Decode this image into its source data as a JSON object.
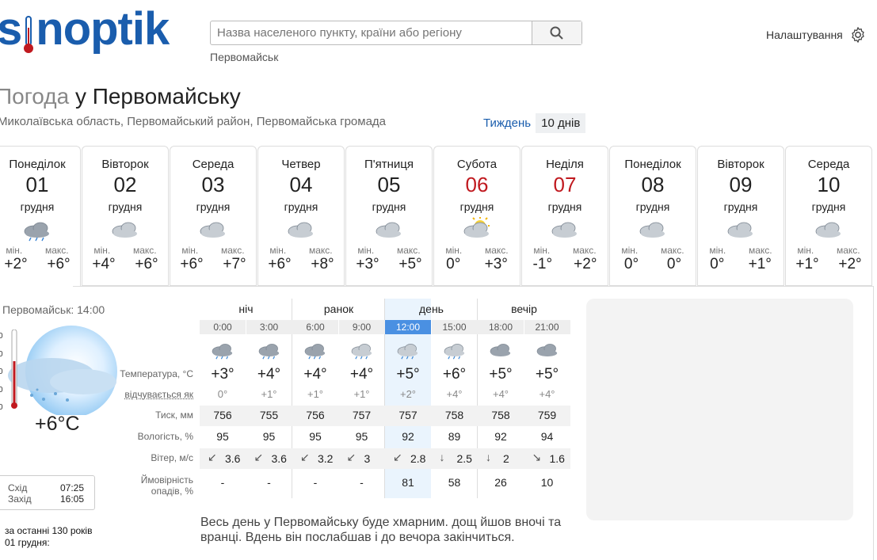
{
  "header": {
    "logo_text": "sinoptik",
    "search_placeholder": "Назва населеного пункту, країни або регіону",
    "suggestion": "Первомайськ",
    "settings_label": "Налаштування"
  },
  "title": {
    "prefix": "Погода",
    "rest": "у Первомайську"
  },
  "region": "Миколаївська область, Первомайський район, Первомайська громада",
  "tabs": {
    "week": "Тиждень",
    "ten_days": "10 днів"
  },
  "days": [
    {
      "weekday": "Понеділок",
      "date": "01",
      "month": "грудня",
      "min_label": "мін.",
      "max_label": "макс.",
      "min": "+2°",
      "max": "+6°",
      "icon": "cloud-rain-icon"
    },
    {
      "weekday": "Вівторок",
      "date": "02",
      "month": "грудня",
      "min_label": "мін.",
      "max_label": "макс.",
      "min": "+4°",
      "max": "+6°",
      "icon": "cloud-icon"
    },
    {
      "weekday": "Середа",
      "date": "03",
      "month": "грудня",
      "min_label": "мін.",
      "max_label": "макс.",
      "min": "+6°",
      "max": "+7°",
      "icon": "cloud-icon"
    },
    {
      "weekday": "Четвер",
      "date": "04",
      "month": "грудня",
      "min_label": "мін.",
      "max_label": "макс.",
      "min": "+6°",
      "max": "+8°",
      "icon": "cloud-icon"
    },
    {
      "weekday": "П'ятниця",
      "date": "05",
      "month": "грудня",
      "min_label": "мін.",
      "max_label": "макс.",
      "min": "+3°",
      "max": "+5°",
      "icon": "cloud-icon"
    },
    {
      "weekday": "Субота",
      "date": "06",
      "month": "грудня",
      "min_label": "мін.",
      "max_label": "макс.",
      "min": "0°",
      "max": "+3°",
      "icon": "sun-cloud-icon"
    },
    {
      "weekday": "Неділя",
      "date": "07",
      "month": "грудня",
      "min_label": "мін.",
      "max_label": "макс.",
      "min": "-1°",
      "max": "+2°",
      "icon": "cloud-icon"
    },
    {
      "weekday": "Понеділок",
      "date": "08",
      "month": "грудня",
      "min_label": "мін.",
      "max_label": "макс.",
      "min": "0°",
      "max": "0°",
      "icon": "cloud-icon"
    },
    {
      "weekday": "Вівторок",
      "date": "09",
      "month": "грудня",
      "min_label": "мін.",
      "max_label": "макс.",
      "min": "0°",
      "max": "+1°",
      "icon": "cloud-icon"
    },
    {
      "weekday": "Середа",
      "date": "10",
      "month": "грудня",
      "min_label": "мін.",
      "max_label": "макс.",
      "min": "+1°",
      "max": "+2°",
      "icon": "cloud-icon"
    }
  ],
  "current": {
    "label": "Первомайськ: 14:00",
    "temp": "+6°C",
    "sunrise_label": "Схід",
    "sunrise": "07:25",
    "sunset_label": "Захід",
    "sunset": "16:05",
    "history_line1": "за останні 130 років",
    "history_line2": "01 грудня:",
    "scale": [
      "0",
      "0",
      "0",
      "0",
      "0"
    ]
  },
  "table": {
    "periods": [
      "ніч",
      "ранок",
      "день",
      "вечір"
    ],
    "times": [
      "0:00",
      "3:00",
      "6:00",
      "9:00",
      "12:00",
      "15:00",
      "18:00",
      "21:00"
    ],
    "labels": {
      "temp": "Температура, °C",
      "feels": "відчувається як",
      "pressure": "Тиск, мм",
      "humidity": "Вологість, %",
      "wind": "Вітер, м/с",
      "precip1": "Ймовірність",
      "precip2": "опадів, %"
    },
    "temp": [
      "+3°",
      "+4°",
      "+4°",
      "+4°",
      "+5°",
      "+6°",
      "+5°",
      "+5°"
    ],
    "feels": [
      "0°",
      "+1°",
      "+1°",
      "+1°",
      "+2°",
      "+4°",
      "+4°",
      "+4°"
    ],
    "pressure": [
      "756",
      "755",
      "756",
      "757",
      "757",
      "758",
      "758",
      "759"
    ],
    "humidity": [
      "95",
      "95",
      "95",
      "95",
      "92",
      "89",
      "92",
      "94"
    ],
    "wind": [
      "3.6",
      "3.6",
      "3.2",
      "3",
      "2.8",
      "2.5",
      "2",
      "1.6"
    ],
    "wind_dir": [
      "↙",
      "↙",
      "↙",
      "↙",
      "↙",
      "↓",
      "↓",
      "↘"
    ],
    "precip": [
      "-",
      "-",
      "-",
      "-",
      "81",
      "58",
      "26",
      "10"
    ],
    "icons": [
      "cloud-rain-icon",
      "cloud-rain-icon",
      "cloud-rain-icon",
      "cloud-drizzle-icon",
      "cloud-drizzle-icon",
      "cloud-drizzle-icon",
      "cloud-dark-icon",
      "cloud-dark-icon"
    ]
  },
  "description": "Весь день у Первомайську буде хмарним. дощ йшов вночі та вранці. Вдень він послабшав і до вечора закінчиться."
}
